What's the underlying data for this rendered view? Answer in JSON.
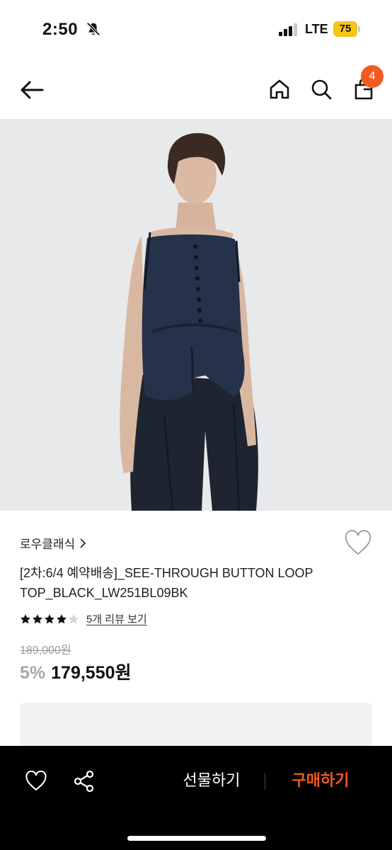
{
  "status_bar": {
    "time": "2:50",
    "network": "LTE",
    "battery": "75",
    "battery_color": "#f5c518"
  },
  "header": {
    "back_icon": "arrow-left-icon",
    "home_icon": "home-icon",
    "search_icon": "search-icon",
    "cart_icon": "shopping-bag-icon",
    "cart_count": "4",
    "accent": "#f25a1f"
  },
  "product": {
    "brand": "로우클래식",
    "title": "[2차:6/4 예약배송]_SEE-THROUGH BUTTON LOOP TOP_BLACK_LW251BL09BK",
    "rating": 4,
    "rating_max": 5,
    "review_link": "5개 리뷰 보기",
    "original_price": "189,000원",
    "discount_rate": "5%",
    "sale_price": "179,550원"
  },
  "bottom_bar": {
    "wish_icon": "heart-icon",
    "share_icon": "share-icon",
    "gift_label": "선물하기",
    "buy_label": "구매하기",
    "buy_color": "#f25a1f"
  }
}
